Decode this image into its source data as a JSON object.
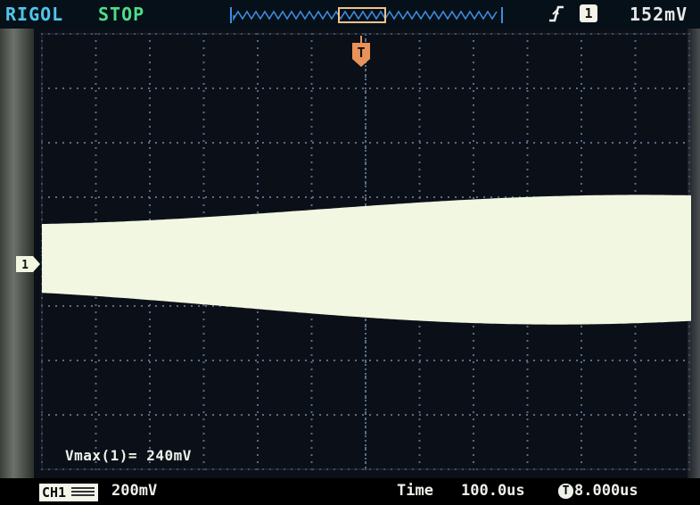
{
  "header": {
    "brand": "RIGOL",
    "run_state": "STOP",
    "trigger_edge_icon": "rising-edge-icon",
    "trigger_channel": "1",
    "trigger_level": "152mV",
    "trigger_position_marker": "T"
  },
  "channel": {
    "marker": "1",
    "tag": "CH1",
    "volts_per_div": "200mV"
  },
  "measurement": {
    "label": "Vmax(1)=",
    "value": "240mV",
    "display": "Vmax(1)= 240mV"
  },
  "timebase": {
    "label": "Time",
    "value": "100.0us",
    "trigger_offset": "8.000us",
    "trigger_offset_icon": "T"
  },
  "colors": {
    "brand": "#4fc6ea",
    "run_state": "#4fdd86",
    "trigger_marker": "#e8935b",
    "trace": "#f2f7e2",
    "grid": "#5a6b85"
  }
}
